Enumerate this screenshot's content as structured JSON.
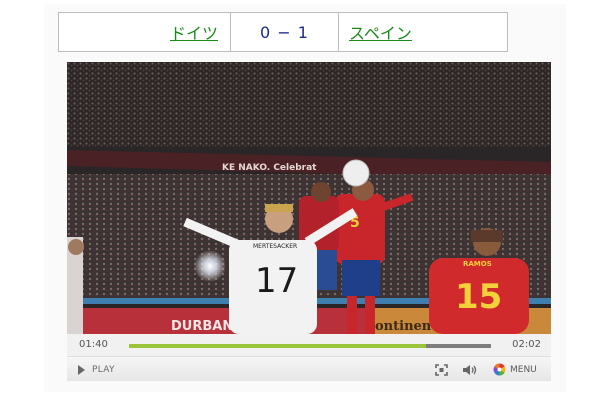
{
  "match": {
    "home_team": "ドイツ",
    "score": "0 − 1",
    "away_team": "スペイン"
  },
  "video": {
    "stadium_banner": "KE NAKO. Celebrat",
    "ad_board_left": "DURBAN",
    "ad_board_right": "ontinent",
    "players": [
      {
        "name": "MERTESACKER",
        "number": "17",
        "kit": "white"
      },
      {
        "name": "RAMOS",
        "number": "15",
        "kit": "red"
      },
      {
        "name": "",
        "number": "5",
        "kit": "red"
      }
    ]
  },
  "player_controls": {
    "current_time": "01:40",
    "total_time": "02:02",
    "progress": 0.82,
    "play_label": "PLAY",
    "menu_label": "MENU",
    "icons": {
      "play": "play-icon",
      "fullscreen": "fullscreen-icon",
      "volume": "volume-icon",
      "menu": "menu-icon"
    },
    "colors": {
      "progress_fill": "#9bc43a",
      "progress_track": "#7d7d7d"
    }
  },
  "colors": {
    "team_link": "#1a8a1a",
    "score_text": "#1b2a8c"
  }
}
